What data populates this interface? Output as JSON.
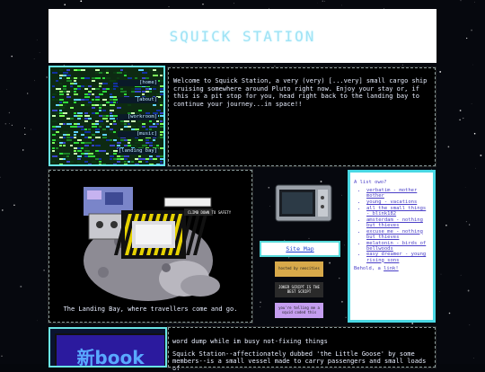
{
  "site": {
    "title": "SQUICK STATION"
  },
  "nav": {
    "links": [
      "[home]",
      "[about]",
      "[workroom]",
      "[music]",
      "[landing bay]"
    ]
  },
  "intro": {
    "text": "Welcome to Squick Station, a very (very) [...very] small cargo ship cruising somewhere around Pluto right now. Enjoy your stay or, if this is a pit stop for you, head right back to the landing bay to continue your journey...in space!!"
  },
  "landing": {
    "caption": "The Landing Bay, where travellers come and go.",
    "hazard_sign": "CLIMB DOWN TO SAFETY"
  },
  "sitemap": {
    "label": "Site Map"
  },
  "badges": [
    {
      "text": "hosted by neocities"
    },
    {
      "text": "JOKER SCRIPT IS THE BEST SCRIPT"
    },
    {
      "text": "you're telling me a squid coded this"
    }
  ],
  "list": {
    "heading": "A list owo?",
    "items": [
      "verbatim - mother mother",
      "young - vacations",
      "all the small things - blink182",
      "amsterdam - nothing but thieves",
      "excuse me - nothing but thieves",
      "melatonin - birds of bellwoods",
      "easy dreamer - young rising sons"
    ],
    "footer_prefix": "Behold, a ",
    "footer_link": "link!"
  },
  "shinbook": {
    "label": "新book"
  },
  "dump": {
    "title": "word dump while im busy not-fixing things",
    "text": "Squick Station--affectionately dubbed 'the Little Goose' by some members--is a small vessel made to carry passengers and small loads of"
  },
  "colors": {
    "accent": "#68e6e6",
    "link": "#4a3fc7",
    "title": "#9fe3f5"
  }
}
